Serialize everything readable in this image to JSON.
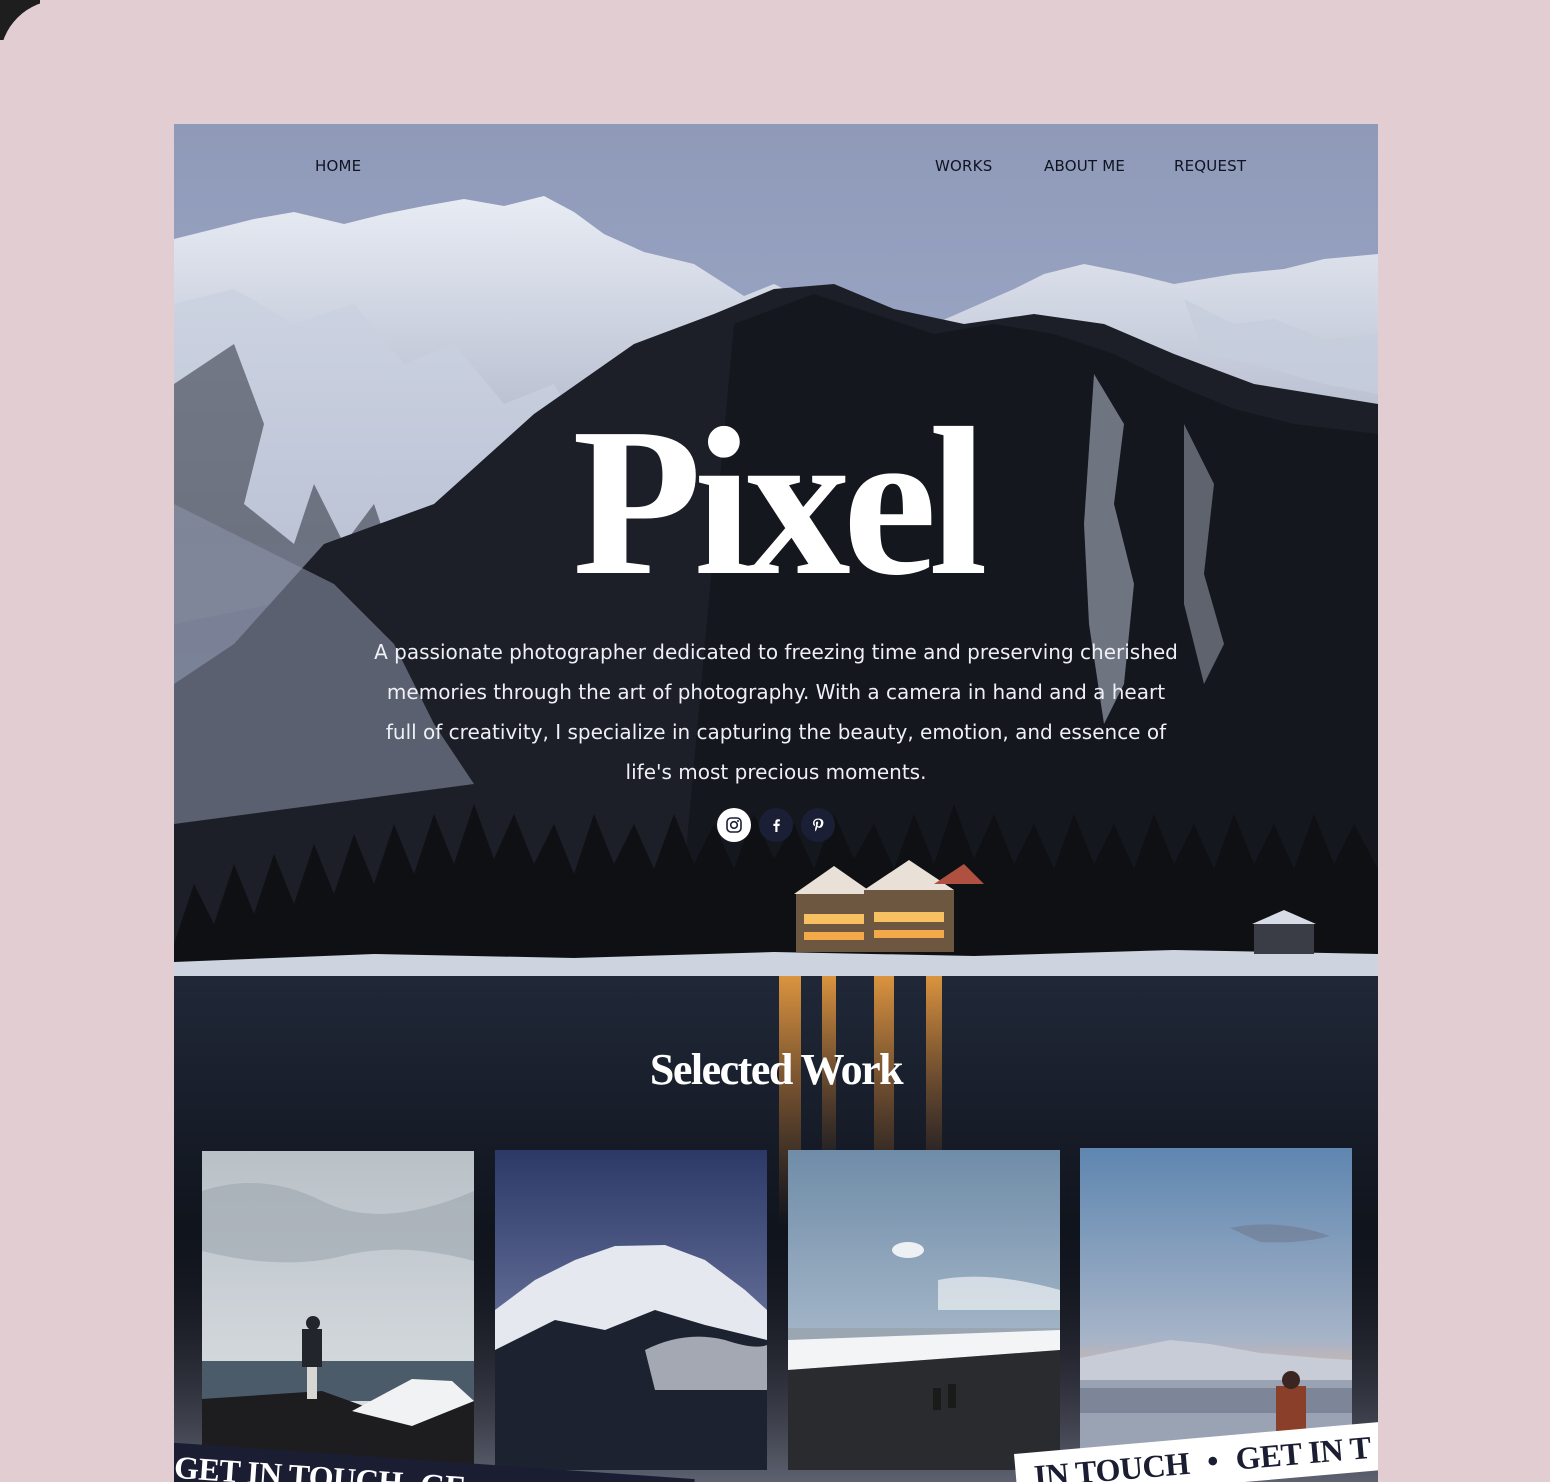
{
  "nav": {
    "home": "HOME",
    "works": "WORKS",
    "about": "ABOUT ME",
    "request": "REQUEST"
  },
  "hero": {
    "brand": "Pixel",
    "intro": "A passionate photographer dedicated to freezing time and preserving cherished memories through the art of photography. With a camera in hand and a heart full of creativity, I specialize in capturing the beauty, emotion, and essence of life's most precious moments."
  },
  "social": [
    "instagram-icon",
    "facebook-icon",
    "pinterest-icon"
  ],
  "work": {
    "title": "Selected Work"
  },
  "banner": {
    "left_text": "GET IN TOUCH",
    "left_text_2": "GE",
    "right_text_1": "IN TOUCH",
    "separator": "•",
    "right_text_2": "GET IN T"
  },
  "colors": {
    "page_background": "#e2cdd2",
    "banner_dark": "#1b1e33",
    "nav_text": "#0f1420",
    "heading": "#ffffff"
  }
}
